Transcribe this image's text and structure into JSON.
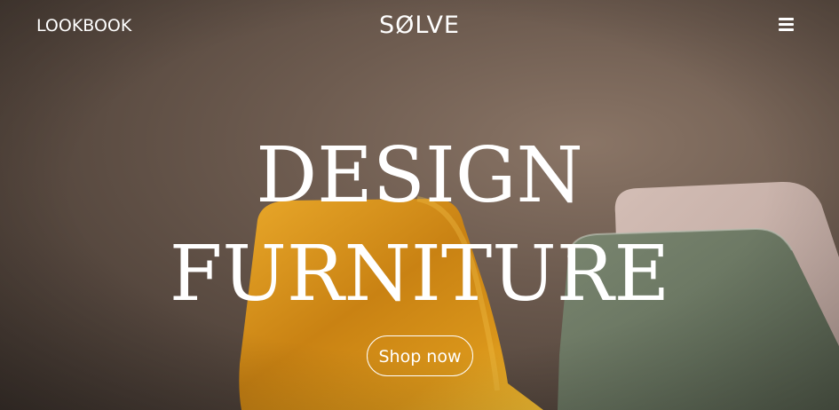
{
  "header": {
    "nav_link": "LOOKBOOK",
    "brand": "SØLVE",
    "menu_icon": "hamburger-menu-icon"
  },
  "hero": {
    "headline_line1": "DESIGN",
    "headline_line2": "FURNITURE",
    "cta_label": "Shop now",
    "image": {
      "subject": "three chairs: yellow, grey-green, blush pink",
      "colors": {
        "yellow_chair": "#e8a423",
        "green_chair": "#6f7c66",
        "pink_chair": "#cdb4ad",
        "backdrop": "#6e5c50"
      }
    }
  }
}
